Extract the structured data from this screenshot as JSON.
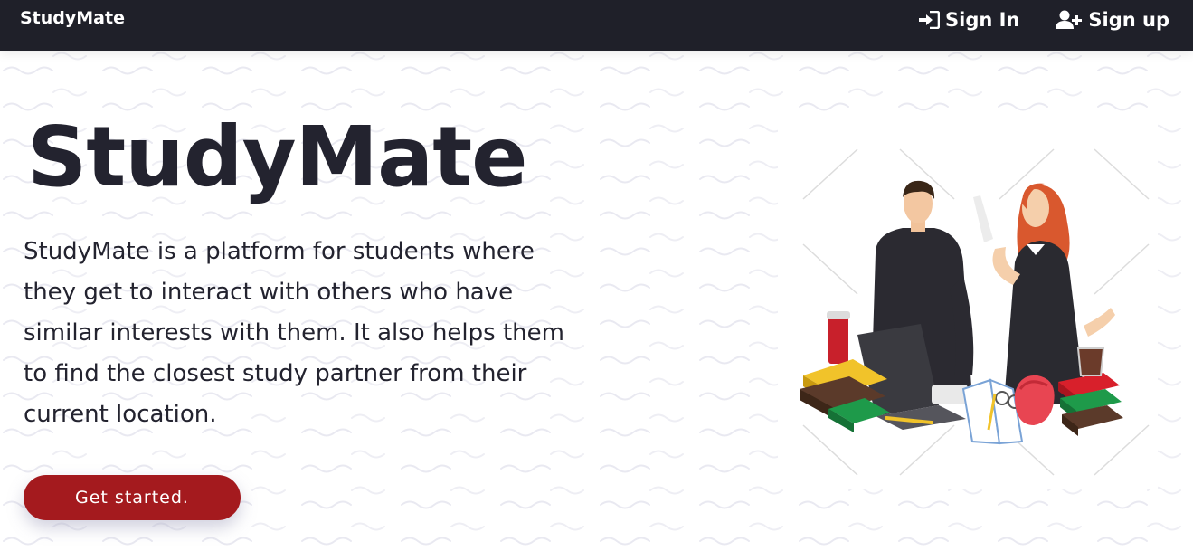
{
  "navbar": {
    "brand": "StudyMate",
    "sign_in_label": "Sign In",
    "sign_up_label": "Sign up",
    "sign_in_icon": "sign-in-icon",
    "sign_up_icon": "user-plus-icon"
  },
  "hero": {
    "title": "StudyMate",
    "description": "StudyMate is a platform for students where they get to interact with others who have similar interests with them. It also helps them to find the closest study partner from their current location.",
    "cta_label": "Get started."
  },
  "colors": {
    "navbar_bg": "#1f2029",
    "text_dark": "#23232f",
    "cta_bg": "#a41a1e"
  }
}
